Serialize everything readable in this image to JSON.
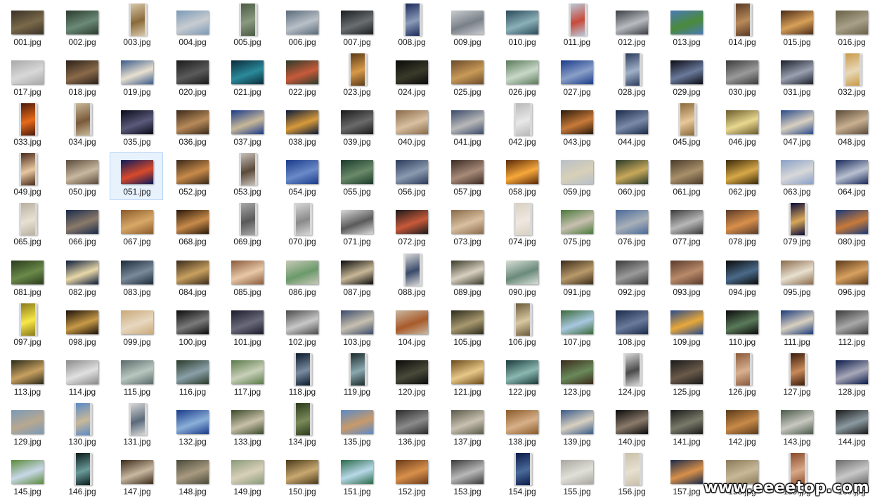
{
  "view": {
    "selected_file": "051.jpg",
    "watermark": "www.eeeetop.com"
  },
  "files": [
    {
      "name": "001.jpg",
      "colors": [
        "#3a3026",
        "#7a6a4a"
      ]
    },
    {
      "name": "002.jpg",
      "colors": [
        "#2a3a2c",
        "#6b8a78"
      ]
    },
    {
      "name": "003.jpg",
      "colors": [
        "#d8c8a8",
        "#8a6a3a"
      ],
      "portrait": true
    },
    {
      "name": "004.jpg",
      "colors": [
        "#7c9ab8",
        "#c8ccd0"
      ]
    },
    {
      "name": "005.jpg",
      "colors": [
        "#4a5a44",
        "#8a9a80"
      ],
      "portrait": true
    },
    {
      "name": "006.jpg",
      "colors": [
        "#5a6a7a",
        "#b8c0c8"
      ]
    },
    {
      "name": "007.jpg",
      "colors": [
        "#1a1e22",
        "#6a6e70"
      ]
    },
    {
      "name": "008.jpg",
      "colors": [
        "#1a2a5a",
        "#8a9ab8"
      ],
      "portrait": true
    },
    {
      "name": "009.jpg",
      "colors": [
        "#c8ccd0",
        "#7a8088"
      ]
    },
    {
      "name": "010.jpg",
      "colors": [
        "#2a4a5a",
        "#8ab0b8"
      ]
    },
    {
      "name": "011.jpg",
      "colors": [
        "#b8c8d8",
        "#c84a3a"
      ],
      "portrait": true
    },
    {
      "name": "012.jpg",
      "colors": [
        "#3a3e44",
        "#b8bcc0"
      ]
    },
    {
      "name": "013.jpg",
      "colors": [
        "#4a7ab8",
        "#4a8a3a"
      ]
    },
    {
      "name": "014.jpg",
      "colors": [
        "#5a3a24",
        "#b88a5a"
      ],
      "portrait": true
    },
    {
      "name": "015.jpg",
      "colors": [
        "#4a2a18",
        "#d8a058"
      ]
    },
    {
      "name": "016.jpg",
      "colors": [
        "#6a6048",
        "#a8a088"
      ]
    },
    {
      "name": "017.jpg",
      "colors": [
        "#a8a8a8",
        "#d8d8d8"
      ]
    },
    {
      "name": "018.jpg",
      "colors": [
        "#2a2018",
        "#8a6a4a"
      ]
    },
    {
      "name": "019.jpg",
      "colors": [
        "#3a5a8a",
        "#e8e0d0"
      ]
    },
    {
      "name": "020.jpg",
      "colors": [
        "#1a1a1a",
        "#5a5a5a"
      ]
    },
    {
      "name": "021.jpg",
      "colors": [
        "#0a2a3a",
        "#2a8a9a"
      ]
    },
    {
      "name": "022.jpg",
      "colors": [
        "#2a3a2a",
        "#c85a3a"
      ]
    },
    {
      "name": "023.jpg",
      "colors": [
        "#5a3a18",
        "#d89a48"
      ],
      "portrait": true
    },
    {
      "name": "024.jpg",
      "colors": [
        "#0a0a0a",
        "#3a3a2a"
      ]
    },
    {
      "name": "025.jpg",
      "colors": [
        "#6a4a2a",
        "#c89a58"
      ]
    },
    {
      "name": "026.jpg",
      "colors": [
        "#5a7a5a",
        "#c8d8c8"
      ]
    },
    {
      "name": "027.jpg",
      "colors": [
        "#1a3a8a",
        "#8aa0c8"
      ]
    },
    {
      "name": "028.jpg",
      "colors": [
        "#2a3a5a",
        "#a0b0c8"
      ],
      "portrait": true
    },
    {
      "name": "029.jpg",
      "colors": [
        "#0a0a14",
        "#6a7a9a"
      ]
    },
    {
      "name": "030.jpg",
      "colors": [
        "#3a3a3a",
        "#9a9a9a"
      ]
    },
    {
      "name": "031.jpg",
      "colors": [
        "#1a1e2a",
        "#9aa0b0"
      ]
    },
    {
      "name": "032.jpg",
      "colors": [
        "#c89a48",
        "#e8d8b8"
      ],
      "portrait": true
    },
    {
      "name": "033.jpg",
      "colors": [
        "#4a1a0a",
        "#e86a1a"
      ],
      "portrait": true
    },
    {
      "name": "034.jpg",
      "colors": [
        "#c8b898",
        "#7a5a3a"
      ],
      "portrait": true
    },
    {
      "name": "035.jpg",
      "colors": [
        "#0a0a1a",
        "#5a5a7a"
      ]
    },
    {
      "name": "036.jpg",
      "colors": [
        "#3a2a1a",
        "#b88a5a"
      ]
    },
    {
      "name": "037.jpg",
      "colors": [
        "#1a3a8a",
        "#c8b898"
      ]
    },
    {
      "name": "038.jpg",
      "colors": [
        "#0a1a3a",
        "#d89a3a"
      ]
    },
    {
      "name": "039.jpg",
      "colors": [
        "#1a1a1a",
        "#6a6a6a"
      ]
    },
    {
      "name": "040.jpg",
      "colors": [
        "#8a6a4a",
        "#d8c0a0"
      ]
    },
    {
      "name": "041.jpg",
      "colors": [
        "#3a4a6a",
        "#b8b8b8"
      ]
    },
    {
      "name": "042.jpg",
      "colors": [
        "#b8b8b8",
        "#e8e8e8"
      ],
      "portrait": true
    },
    {
      "name": "043.jpg",
      "colors": [
        "#2a1a0a",
        "#c87a3a"
      ]
    },
    {
      "name": "044.jpg",
      "colors": [
        "#1a2a4a",
        "#7a8aa8"
      ]
    },
    {
      "name": "045.jpg",
      "colors": [
        "#8a6a3a",
        "#e8c898"
      ],
      "portrait": true
    },
    {
      "name": "046.jpg",
      "colors": [
        "#6a5a2a",
        "#e8d890"
      ]
    },
    {
      "name": "047.jpg",
      "colors": [
        "#2a4a8a",
        "#d8d0c0"
      ]
    },
    {
      "name": "048.jpg",
      "colors": [
        "#5a4a3a",
        "#c8b090"
      ]
    },
    {
      "name": "049.jpg",
      "colors": [
        "#4a2a1a",
        "#e8c8a0"
      ],
      "portrait": true
    },
    {
      "name": "050.jpg",
      "colors": [
        "#5a4a3a",
        "#c8b8a0"
      ]
    },
    {
      "name": "051.jpg",
      "colors": [
        "#0a1a5a",
        "#d84a2a"
      ]
    },
    {
      "name": "052.jpg",
      "colors": [
        "#3a2a1a",
        "#c88a4a"
      ]
    },
    {
      "name": "053.jpg",
      "colors": [
        "#c8c0b8",
        "#5a4a3a"
      ],
      "portrait": true
    },
    {
      "name": "054.jpg",
      "colors": [
        "#1a3a8a",
        "#6a8ac8"
      ]
    },
    {
      "name": "055.jpg",
      "colors": [
        "#1a3a2a",
        "#6a8a6a"
      ]
    },
    {
      "name": "056.jpg",
      "colors": [
        "#2a3a5a",
        "#8a9ab0"
      ]
    },
    {
      "name": "057.jpg",
      "colors": [
        "#3a2a24",
        "#a88a78"
      ]
    },
    {
      "name": "058.jpg",
      "colors": [
        "#5a2a0a",
        "#f8a83a"
      ]
    },
    {
      "name": "059.jpg",
      "colors": [
        "#b8c0c8",
        "#d8d0b8"
      ]
    },
    {
      "name": "060.jpg",
      "colors": [
        "#2a3a2a",
        "#c8a85a"
      ]
    },
    {
      "name": "061.jpg",
      "colors": [
        "#4a3a2a",
        "#a8906a"
      ]
    },
    {
      "name": "062.jpg",
      "colors": [
        "#3a2a0a",
        "#d8a848"
      ]
    },
    {
      "name": "063.jpg",
      "colors": [
        "#8aa0c8",
        "#d8d8d8"
      ]
    },
    {
      "name": "064.jpg",
      "colors": [
        "#1a2a5a",
        "#b8c0d0"
      ]
    },
    {
      "name": "065.jpg",
      "colors": [
        "#b8b0a0",
        "#e8e0d0"
      ],
      "portrait": true
    },
    {
      "name": "066.jpg",
      "colors": [
        "#1a2a4a",
        "#8a7a6a"
      ]
    },
    {
      "name": "067.jpg",
      "colors": [
        "#8a5a2a",
        "#d8a868"
      ]
    },
    {
      "name": "068.jpg",
      "colors": [
        "#2a1a0a",
        "#c88a4a"
      ]
    },
    {
      "name": "069.jpg",
      "colors": [
        "#a8a8a8",
        "#5a5a5a"
      ],
      "portrait": true
    },
    {
      "name": "070.jpg",
      "colors": [
        "#d8d8d8",
        "#8a8a8a"
      ],
      "portrait": true
    },
    {
      "name": "071.jpg",
      "colors": [
        "#d8d8d8",
        "#5a5a5a"
      ]
    },
    {
      "name": "072.jpg",
      "colors": [
        "#1a1a1a",
        "#c85a3a"
      ]
    },
    {
      "name": "073.jpg",
      "colors": [
        "#8a6a4a",
        "#d8c0a0"
      ]
    },
    {
      "name": "074.jpg",
      "colors": [
        "#d8d0c0",
        "#f0e8e0"
      ],
      "portrait": true
    },
    {
      "name": "075.jpg",
      "colors": [
        "#4a7a3a",
        "#c8c0b0"
      ]
    },
    {
      "name": "076.jpg",
      "colors": [
        "#4a6a9a",
        "#a8b0b8"
      ]
    },
    {
      "name": "077.jpg",
      "colors": [
        "#3a3a3a",
        "#b8b8b8"
      ]
    },
    {
      "name": "078.jpg",
      "colors": [
        "#5a3a2a",
        "#d8904a"
      ]
    },
    {
      "name": "079.jpg",
      "colors": [
        "#0a0a3a",
        "#d8a858"
      ],
      "portrait": true
    },
    {
      "name": "080.jpg",
      "colors": [
        "#1a3a7a",
        "#c87a3a"
      ]
    },
    {
      "name": "081.jpg",
      "colors": [
        "#2a3a1a",
        "#6a8a4a"
      ]
    },
    {
      "name": "082.jpg",
      "colors": [
        "#0a1a3a",
        "#e8d8a8"
      ]
    },
    {
      "name": "083.jpg",
      "colors": [
        "#1a2a3a",
        "#7a8a9a"
      ]
    },
    {
      "name": "084.jpg",
      "colors": [
        "#3a2a1a",
        "#c8a060"
      ]
    },
    {
      "name": "085.jpg",
      "colors": [
        "#8a5a3a",
        "#e8c8a8"
      ]
    },
    {
      "name": "086.jpg",
      "colors": [
        "#c8c8b8",
        "#6a9a6a"
      ]
    },
    {
      "name": "087.jpg",
      "colors": [
        "#0a0a0a",
        "#c8b898"
      ]
    },
    {
      "name": "088.jpg",
      "colors": [
        "#d8d8d8",
        "#3a4a6a"
      ],
      "portrait": true
    },
    {
      "name": "089.jpg",
      "colors": [
        "#3a3a2a",
        "#d8d0c0"
      ]
    },
    {
      "name": "090.jpg",
      "colors": [
        "#d8e0d8",
        "#6a8a7a"
      ]
    },
    {
      "name": "091.jpg",
      "colors": [
        "#3a2a1a",
        "#b89a6a"
      ]
    },
    {
      "name": "092.jpg",
      "colors": [
        "#3a3a3a",
        "#9a9a9a"
      ]
    },
    {
      "name": "093.jpg",
      "colors": [
        "#5a3a2a",
        "#b88a6a"
      ]
    },
    {
      "name": "094.jpg",
      "colors": [
        "#0a0a0a",
        "#4a6a8a"
      ]
    },
    {
      "name": "095.jpg",
      "colors": [
        "#8a6a4a",
        "#e8e0d0"
      ]
    },
    {
      "name": "096.jpg",
      "colors": [
        "#5a3a1a",
        "#d8a060"
      ]
    },
    {
      "name": "097.jpg",
      "colors": [
        "#8a7a1a",
        "#f8e848"
      ],
      "portrait": true
    },
    {
      "name": "098.jpg",
      "colors": [
        "#1a1008",
        "#c89a48"
      ]
    },
    {
      "name": "099.jpg",
      "colors": [
        "#c8a878",
        "#e8d8c0"
      ]
    },
    {
      "name": "100.jpg",
      "colors": [
        "#0a0a0a",
        "#7a7a7a"
      ]
    },
    {
      "name": "101.jpg",
      "colors": [
        "#1a1a2a",
        "#6a6a7a"
      ]
    },
    {
      "name": "102.jpg",
      "colors": [
        "#4a4a4a",
        "#c8c8c8"
      ]
    },
    {
      "name": "103.jpg",
      "colors": [
        "#3a4a6a",
        "#c8c0b0"
      ]
    },
    {
      "name": "104.jpg",
      "colors": [
        "#c8b8a0",
        "#a85a2a"
      ]
    },
    {
      "name": "105.jpg",
      "colors": [
        "#2a2a1a",
        "#a89870"
      ]
    },
    {
      "name": "106.jpg",
      "colors": [
        "#6a5a3a",
        "#d8c8a0"
      ],
      "portrait": true
    },
    {
      "name": "107.jpg",
      "colors": [
        "#3a6a3a",
        "#a8c8e0"
      ]
    },
    {
      "name": "108.jpg",
      "colors": [
        "#1a2a4a",
        "#6a7a9a"
      ]
    },
    {
      "name": "109.jpg",
      "colors": [
        "#2a4a8a",
        "#e8a83a"
      ]
    },
    {
      "name": "110.jpg",
      "colors": [
        "#0a0a0a",
        "#5a7a5a"
      ]
    },
    {
      "name": "111.jpg",
      "colors": [
        "#1a3a7a",
        "#d8d0c0"
      ]
    },
    {
      "name": "112.jpg",
      "colors": [
        "#3a3a3a",
        "#a8a8a8"
      ]
    },
    {
      "name": "113.jpg",
      "colors": [
        "#2a2a1a",
        "#c8a060"
      ]
    },
    {
      "name": "114.jpg",
      "colors": [
        "#8a8a8a",
        "#e0e0e0"
      ]
    },
    {
      "name": "115.jpg",
      "colors": [
        "#5a6a6a",
        "#b8c8c0"
      ]
    },
    {
      "name": "116.jpg",
      "colors": [
        "#2a3a2a",
        "#8aa0a8"
      ]
    },
    {
      "name": "117.jpg",
      "colors": [
        "#5a7a4a",
        "#c8d0b8"
      ]
    },
    {
      "name": "118.jpg",
      "colors": [
        "#0a1a2a",
        "#7a8aa0"
      ],
      "portrait": true
    },
    {
      "name": "119.jpg",
      "colors": [
        "#1a2a2a",
        "#8aa8b0"
      ],
      "portrait": true
    },
    {
      "name": "120.jpg",
      "colors": [
        "#0a0a0a",
        "#4a4a3a"
      ]
    },
    {
      "name": "121.jpg",
      "colors": [
        "#6a4a1a",
        "#e8c888"
      ]
    },
    {
      "name": "122.jpg",
      "colors": [
        "#1a3a3a",
        "#8ab8b0"
      ]
    },
    {
      "name": "123.jpg",
      "colors": [
        "#3a2a1a",
        "#6a8a5a"
      ]
    },
    {
      "name": "124.jpg",
      "colors": [
        "#d8d8d8",
        "#4a4a4a"
      ],
      "portrait": true
    },
    {
      "name": "125.jpg",
      "colors": [
        "#1a1a1a",
        "#6a5a4a"
      ]
    },
    {
      "name": "126.jpg",
      "colors": [
        "#8a5a3a",
        "#d8b090"
      ],
      "portrait": true
    },
    {
      "name": "127.jpg",
      "colors": [
        "#3a1a0a",
        "#c88a5a"
      ],
      "portrait": true
    },
    {
      "name": "128.jpg",
      "colors": [
        "#0a1a4a",
        "#a8a8b8"
      ]
    },
    {
      "name": "129.jpg",
      "colors": [
        "#7a9ab8",
        "#b8a890"
      ]
    },
    {
      "name": "130.jpg",
      "colors": [
        "#5a8ac8",
        "#c8b898"
      ],
      "portrait": true
    },
    {
      "name": "131.jpg",
      "colors": [
        "#d8d8d8",
        "#5a6a7a"
      ],
      "portrait": true
    },
    {
      "name": "132.jpg",
      "colors": [
        "#1a3a8a",
        "#8ab0d8"
      ]
    },
    {
      "name": "133.jpg",
      "colors": [
        "#3a4a2a",
        "#c8c0a8"
      ]
    },
    {
      "name": "134.jpg",
      "colors": [
        "#2a3a1a",
        "#7a8a5a"
      ],
      "portrait": true
    },
    {
      "name": "135.jpg",
      "colors": [
        "#5a8ac8",
        "#c89a6a"
      ]
    },
    {
      "name": "136.jpg",
      "colors": [
        "#2a2a2a",
        "#8a8a8a"
      ]
    },
    {
      "name": "137.jpg",
      "colors": [
        "#5a5a4a",
        "#c8c0b0"
      ]
    },
    {
      "name": "138.jpg",
      "colors": [
        "#8a5a2a",
        "#d8b088"
      ]
    },
    {
      "name": "139.jpg",
      "colors": [
        "#3a5a8a",
        "#d8d0c0"
      ]
    },
    {
      "name": "140.jpg",
      "colors": [
        "#0a0a0a",
        "#8a7a6a"
      ]
    },
    {
      "name": "141.jpg",
      "colors": [
        "#1a1a1a",
        "#7a7a6a"
      ]
    },
    {
      "name": "142.jpg",
      "colors": [
        "#5a3a1a",
        "#c88a48"
      ]
    },
    {
      "name": "143.jpg",
      "colors": [
        "#4a5a4a",
        "#c8c8c0"
      ]
    },
    {
      "name": "144.jpg",
      "colors": [
        "#1a1a1a",
        "#8a9aa0"
      ]
    },
    {
      "name": "145.jpg",
      "colors": [
        "#5a8a3a",
        "#c8d8e8"
      ]
    },
    {
      "name": "146.jpg",
      "colors": [
        "#0a1a1a",
        "#6a9a9a"
      ],
      "portrait": true
    },
    {
      "name": "147.jpg",
      "colors": [
        "#3a2a1a",
        "#c8b8a0"
      ]
    },
    {
      "name": "148.jpg",
      "colors": [
        "#4a4a3a",
        "#a89a80"
      ]
    },
    {
      "name": "149.jpg",
      "colors": [
        "#8a9a7a",
        "#d8d0b8"
      ]
    },
    {
      "name": "150.jpg",
      "colors": [
        "#4a3a1a",
        "#c8a870"
      ]
    },
    {
      "name": "151.jpg",
      "colors": [
        "#2a6a4a",
        "#b8d8e8"
      ]
    },
    {
      "name": "152.jpg",
      "colors": [
        "#6a3a1a",
        "#d8904a"
      ]
    },
    {
      "name": "153.jpg",
      "colors": [
        "#3a3a3a",
        "#b8b8b8"
      ]
    },
    {
      "name": "154.jpg",
      "colors": [
        "#0a1a4a",
        "#4a6a9a"
      ],
      "portrait": true
    },
    {
      "name": "155.jpg",
      "colors": [
        "#a8a8a0",
        "#e0e0d8"
      ]
    },
    {
      "name": "156.jpg",
      "colors": [
        "#c8c0a8",
        "#e8e0d0"
      ],
      "portrait": true
    },
    {
      "name": "157.jpg",
      "colors": [
        "#1a2a4a",
        "#d8904a"
      ]
    },
    {
      "name": "158.jpg",
      "colors": [
        "#8a7a5a",
        "#c8b898"
      ]
    },
    {
      "name": "159.jpg",
      "colors": [
        "#8a4a2a",
        "#d8a888"
      ],
      "portrait": true
    },
    {
      "name": "160.jpg",
      "colors": [
        "#6a6a6a",
        "#c8c8c8"
      ]
    }
  ]
}
